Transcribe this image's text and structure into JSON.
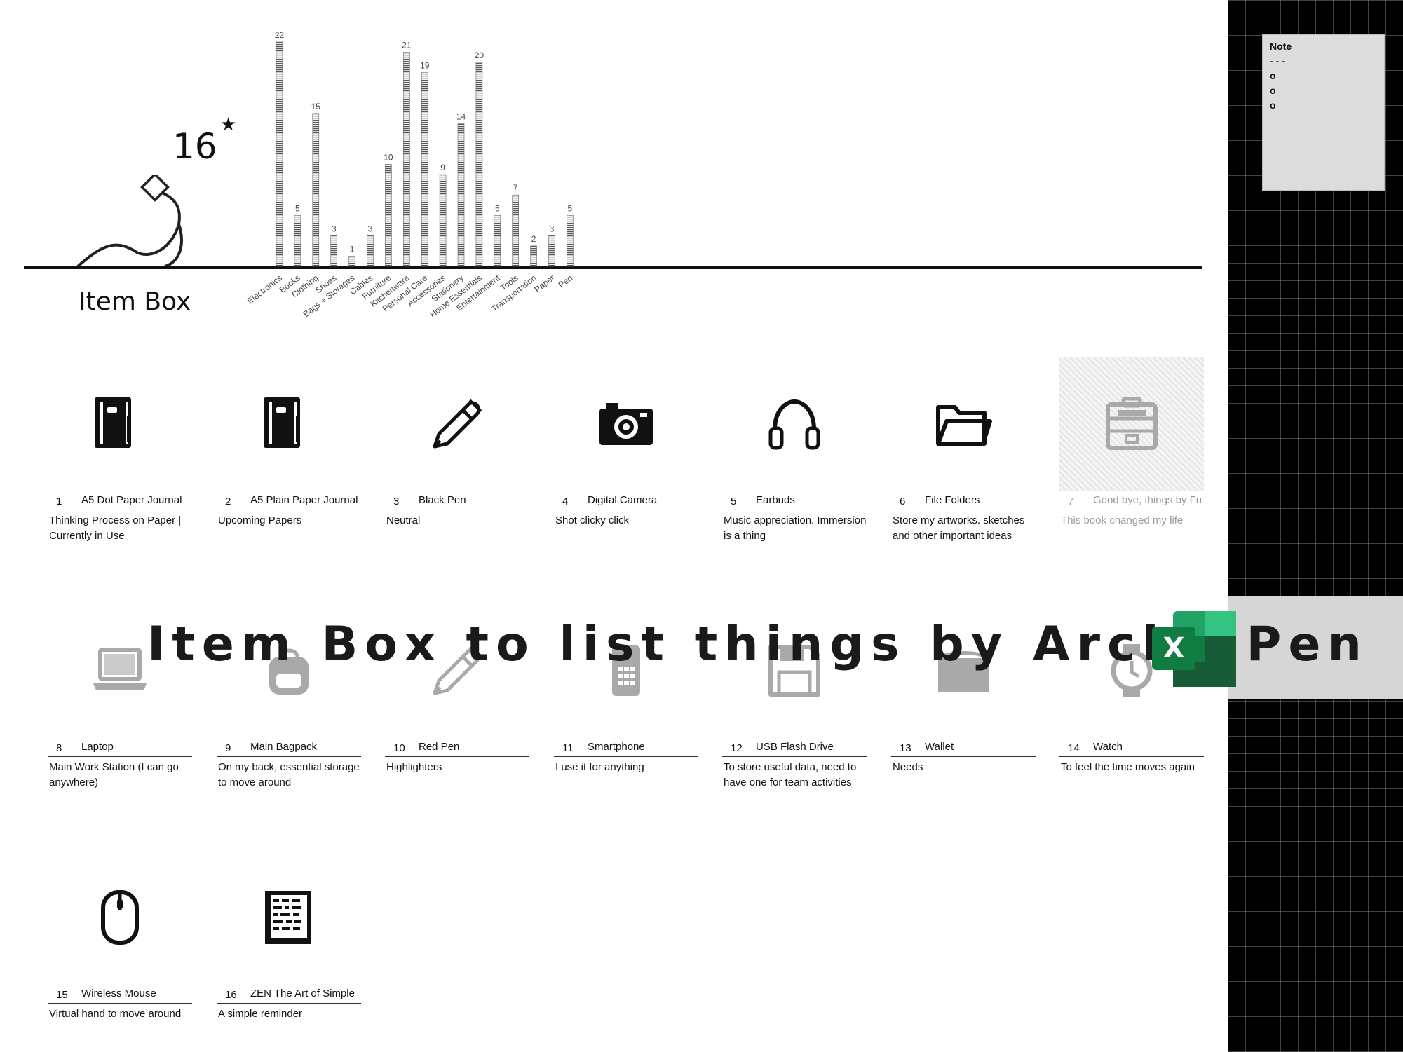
{
  "header": {
    "item_count": "16",
    "title": "Item Box"
  },
  "banner": {
    "title": "Item Box to list things by Arche Pen"
  },
  "note": {
    "title": "Note",
    "lines": [
      "- - -",
      "o",
      "o",
      "o"
    ]
  },
  "chart_data": {
    "type": "bar",
    "categories": [
      "Electronics",
      "Books",
      "Clothing",
      "Shoes",
      "Bags + Storages",
      "Cables",
      "Furniture",
      "Kitchenware",
      "Personal Care",
      "Accessories",
      "Stationery",
      "Home Essentials",
      "Entertainment",
      "Tools",
      "Transportation",
      "Paper",
      "Pen"
    ],
    "values": [
      22,
      5,
      15,
      3,
      1,
      3,
      10,
      21,
      19,
      9,
      14,
      20,
      5,
      7,
      2,
      3,
      5
    ],
    "ylim": [
      0,
      22
    ]
  },
  "items": [
    {
      "num": "1",
      "name": "A5 Dot Paper Journal",
      "desc": "Thinking Process on Paper | Currently in Use",
      "icon": "journal-icon"
    },
    {
      "num": "2",
      "name": "A5 Plain Paper Journal",
      "desc": "Upcoming Papers",
      "icon": "journal-icon"
    },
    {
      "num": "3",
      "name": "Black Pen",
      "desc": "Neutral",
      "icon": "pen-icon"
    },
    {
      "num": "4",
      "name": "Digital Camera",
      "desc": "Shot clicky click",
      "icon": "camera-icon"
    },
    {
      "num": "5",
      "name": "Earbuds",
      "desc": "Music appreciation. Immersion is a thing",
      "icon": "headphones-icon"
    },
    {
      "num": "6",
      "name": "File Folders",
      "desc": "Store my artworks. sketches and other important ideas",
      "icon": "folder-icon"
    },
    {
      "num": "7",
      "name": "Good bye, things by Fu",
      "desc": "This book changed my life",
      "icon": "cabinet-icon"
    },
    {
      "num": "8",
      "name": "Laptop",
      "desc": "Main Work Station (I can go anywhere)",
      "icon": "laptop-icon"
    },
    {
      "num": "9",
      "name": "Main Bagpack",
      "desc": "On my back, essential storage to move around",
      "icon": "backpack-icon"
    },
    {
      "num": "10",
      "name": "Red Pen",
      "desc": "Highlighters",
      "icon": "pen-icon"
    },
    {
      "num": "11",
      "name": "Smartphone",
      "desc": "I use it for anything",
      "icon": "smartphone-icon"
    },
    {
      "num": "12",
      "name": "USB Flash Drive",
      "desc": "To store useful data, need to have one for team activities",
      "icon": "floppy-icon"
    },
    {
      "num": "13",
      "name": "Wallet",
      "desc": "Needs",
      "icon": "wallet-icon"
    },
    {
      "num": "14",
      "name": "Watch",
      "desc": "To feel the time moves again",
      "icon": "watch-icon"
    },
    {
      "num": "15",
      "name": "Wireless Mouse",
      "desc": "Virtual hand to move around",
      "icon": "mouse-icon"
    },
    {
      "num": "16",
      "name": "ZEN The Art of Simple",
      "desc": "A simple reminder",
      "icon": "book-icon"
    }
  ]
}
